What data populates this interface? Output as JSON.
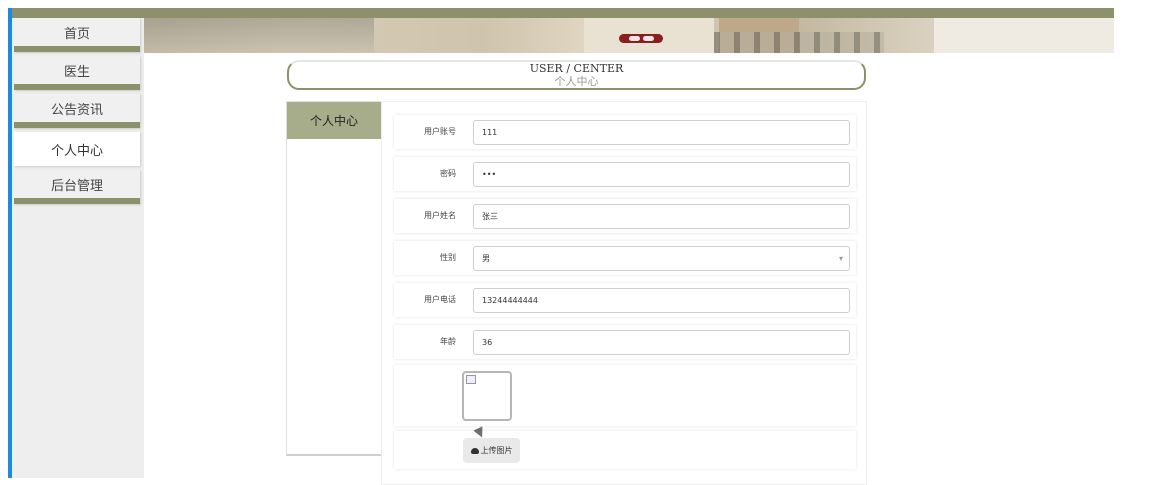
{
  "sidebar": {
    "items": [
      {
        "label": "首页",
        "active": false
      },
      {
        "label": "医生",
        "active": false
      },
      {
        "label": "公告资讯",
        "active": false
      },
      {
        "label": "个人中心",
        "active": true
      },
      {
        "label": "后台管理",
        "active": false
      }
    ]
  },
  "header": {
    "title_en": "USER / CENTER",
    "title_cn": "个人中心"
  },
  "subnav": {
    "items": [
      {
        "label": "个人中心",
        "active": true
      }
    ]
  },
  "form": {
    "fields": [
      {
        "label": "用户账号",
        "value": "111"
      },
      {
        "label": "密码",
        "value": "•••"
      },
      {
        "label": "用户姓名",
        "value": "张三"
      },
      {
        "label": "性别",
        "value": "男"
      },
      {
        "label": "用户电话",
        "value": "13244444444"
      },
      {
        "label": "年龄",
        "value": "36"
      }
    ],
    "upload_label": "上传图片"
  },
  "colors": {
    "accent": "#8c916b",
    "subnav_active": "#a7ac8a",
    "edge": "#1a8be0"
  }
}
